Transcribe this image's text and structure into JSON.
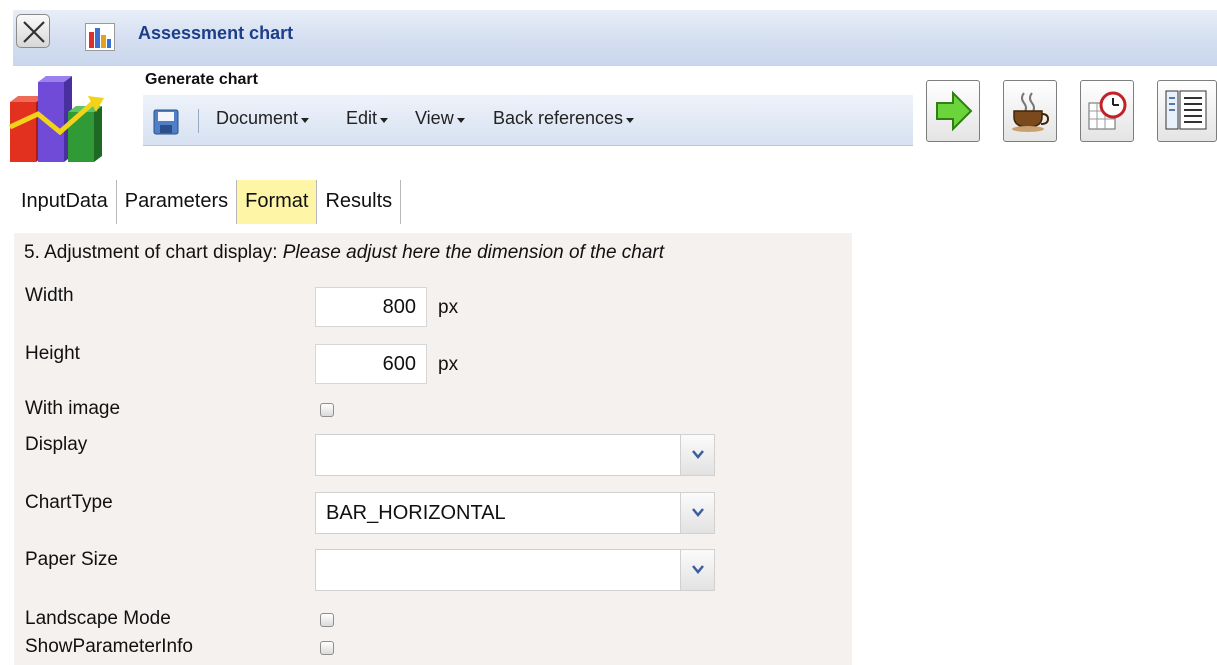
{
  "window": {
    "title": "Assessment chart"
  },
  "header": {
    "title": "Generate chart",
    "menu": [
      {
        "label": "Document"
      },
      {
        "label": "Edit"
      },
      {
        "label": "View"
      },
      {
        "label": "Back references"
      }
    ],
    "toolbar_icons": [
      "run-arrow-icon",
      "coffee-cup-icon",
      "calendar-clock-icon",
      "list-view-icon"
    ]
  },
  "tabs": [
    {
      "label": "InputData",
      "active": false
    },
    {
      "label": "Parameters",
      "active": false
    },
    {
      "label": "Format",
      "active": true
    },
    {
      "label": "Results",
      "active": false
    }
  ],
  "form": {
    "section_number": "5. Adjustment of chart display:",
    "section_hint": "Please adjust here the dimension of the chart",
    "width": {
      "label": "Width",
      "value": "800",
      "unit": "px"
    },
    "height": {
      "label": "Height",
      "value": "600",
      "unit": "px"
    },
    "with_image": {
      "label": "With image",
      "checked": false
    },
    "display": {
      "label": "Display",
      "value": ""
    },
    "chart_type": {
      "label": "ChartType",
      "value": "BAR_HORIZONTAL"
    },
    "paper_size": {
      "label": "Paper Size",
      "value": ""
    },
    "landscape_mode": {
      "label": "Landscape Mode",
      "checked": false
    },
    "show_parameter_info": {
      "label": "ShowParameterInfo",
      "checked": false
    }
  },
  "colors": {
    "title_text": "#1d3f8a",
    "active_tab": "#fef5a6",
    "panel_bg": "#f4f1ef"
  }
}
